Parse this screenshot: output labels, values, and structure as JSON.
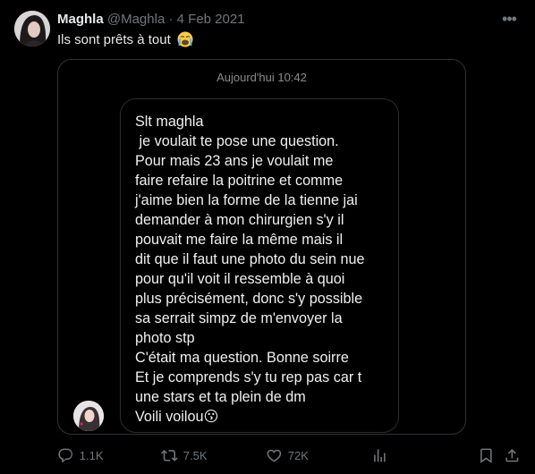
{
  "tweet": {
    "author_name": "Maghla",
    "handle": "@Maghla",
    "separator": "·",
    "date": "4 Feb 2021",
    "text": "Ils sont prêts à tout",
    "emoji": "loudly-crying-face"
  },
  "media": {
    "timestamp": "Aujourd'hui 10:42",
    "message_lines": [
      "Slt maghla",
      " je voulait te pose une question.",
      "Pour mais 23 ans je voulait me",
      "faire refaire la poitrine et comme",
      "j'aime bien la forme de la tienne jai",
      "demander à mon chirurgien s'y il",
      "pouvait me faire la même mais il",
      "dit que il faut une photo du sein nue",
      "pour qu'il voit il ressemble à quoi",
      "plus précisément, donc s'y possible",
      "sa serrait simpz de m'envoyer la",
      "photo stp",
      "C'était ma question. Bonne soirre",
      "Et je comprends s'y tu rep pas car t",
      "une stars et ta plein de dm",
      "Voili voilou😗"
    ]
  },
  "actions": {
    "reply_count": "1.1K",
    "retweet_count": "7.5K",
    "like_count": "72K"
  },
  "colors": {
    "background": "#000000",
    "text_primary": "#e7e9ea",
    "text_secondary": "#71767b",
    "border": "#2f3336",
    "emoji_yellow": "#ffcc4d"
  }
}
